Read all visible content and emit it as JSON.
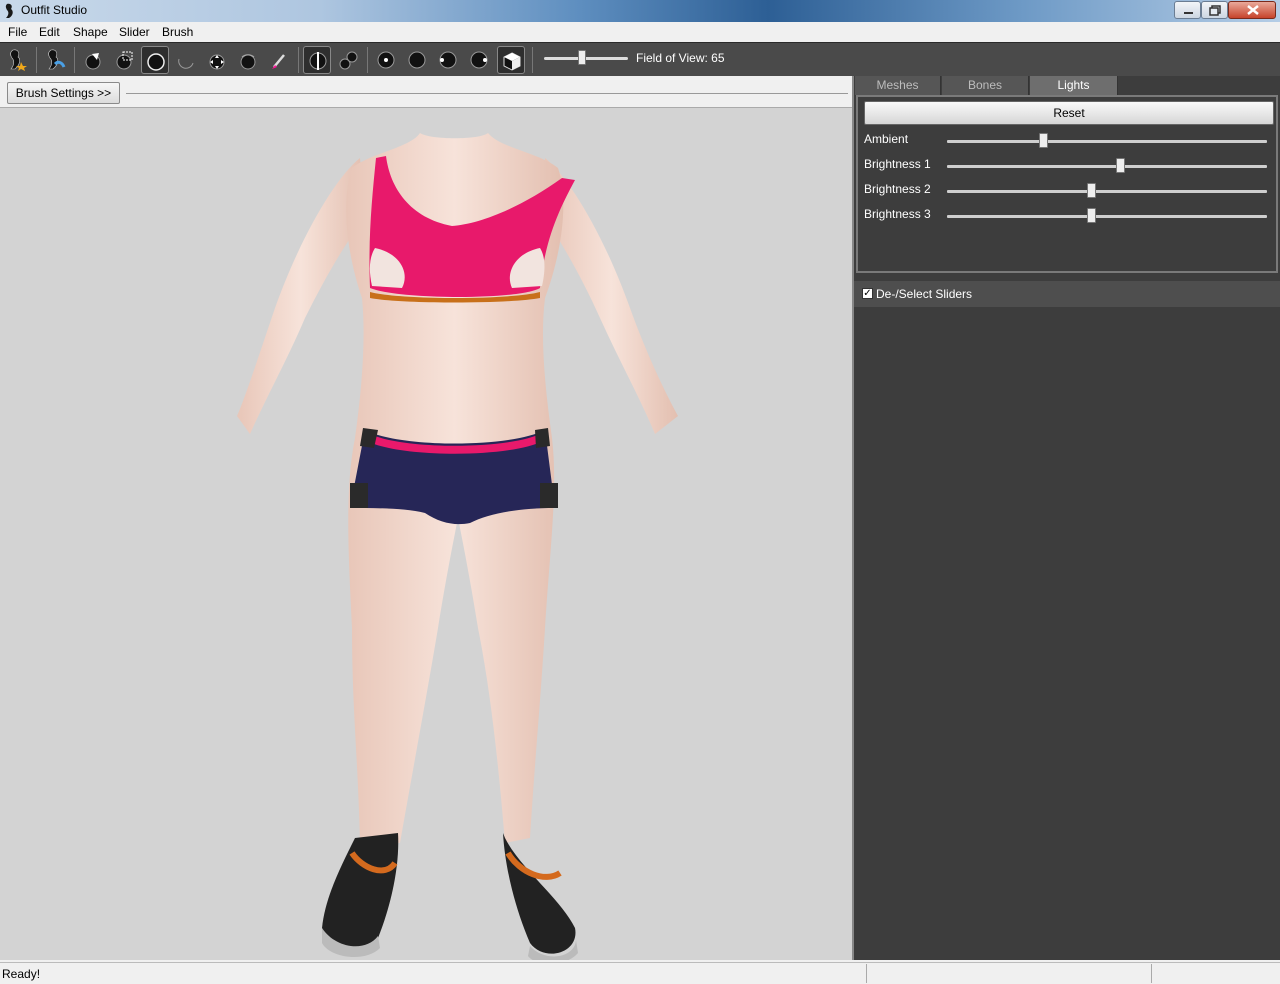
{
  "window": {
    "title": "Outfit Studio"
  },
  "menu": [
    "File",
    "Edit",
    "Shape",
    "Slider",
    "Brush"
  ],
  "toolbar": {
    "fov_label": "Field of View: 65",
    "fov_value": 65
  },
  "brush_settings": {
    "label": "Brush Settings >>"
  },
  "tabs": [
    {
      "label": "Meshes",
      "active": false
    },
    {
      "label": "Bones",
      "active": false
    },
    {
      "label": "Lights",
      "active": true
    }
  ],
  "lights": {
    "reset_label": "Reset",
    "sliders": [
      {
        "label": "Ambient",
        "value_fraction": 0.3
      },
      {
        "label": "Brightness 1",
        "value_fraction": 0.54
      },
      {
        "label": "Brightness 2",
        "value_fraction": 0.45
      },
      {
        "label": "Brightness 3",
        "value_fraction": 0.45
      }
    ]
  },
  "sliders_panel": {
    "deselect_label": "De-/Select Sliders",
    "checked": true
  },
  "status": {
    "text": "Ready!"
  },
  "colors": {
    "toolbar_bg": "#4a4a4a",
    "panel_bg": "#3d3d3d",
    "viewport_bg": "#d3d3d3",
    "top_pink": "#e8196b",
    "shorts_navy": "#262657"
  }
}
